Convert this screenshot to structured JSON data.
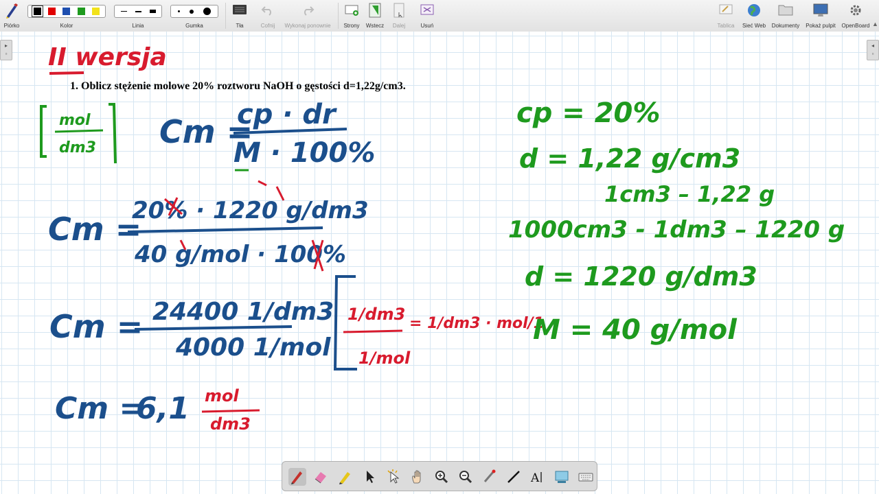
{
  "toolbar": {
    "pen_label": "Piórko",
    "color_label": "Kolor",
    "line_label": "Linia",
    "eraser_label": "Gumka",
    "background_label": "Tła",
    "undo_label": "Cofnij",
    "redo_label": "Wykonaj ponownie",
    "pages_label": "Strony",
    "back_label": "Wstecz",
    "next_label": "Dalej",
    "delete_label": "Usuń",
    "board_label": "Tablica",
    "web_label": "Sieć Web",
    "documents_label": "Dokumenty",
    "desktop_label": "Pokaż pulpit",
    "openboard_label": "OpenBoard",
    "colors": [
      "#000000",
      "#e00000",
      "#1e4fb0",
      "#1e9a1e",
      "#f2e21a"
    ]
  },
  "board": {
    "problem_text": "1. Oblicz stężenie molowe 20% roztworu NaOH o gęstości d=1,22g/cm3.",
    "ink_colors": {
      "red": "#d81b2e",
      "blue": "#1b4f8c",
      "green": "#1e9a1e"
    },
    "handwriting": {
      "title": "II wersja",
      "unit_box_num": "mol",
      "unit_box_den": "dm3",
      "formula_lhs": "Cm =",
      "formula_num": "cp · dr",
      "formula_den": "M · 100%",
      "step1_lhs": "Cm =",
      "step1_num": "20% · 1220 g/dm3",
      "step1_den": "40 g/mol · 100%",
      "step2_lhs": "Cm =",
      "step2_num": "24400 1/dm3",
      "step2_den": "4000 1/mol",
      "unit_num": "1/dm3",
      "unit_den": "1/mol",
      "unit_eq": "= 1/dm3 · mol/1",
      "result_lhs": "Cm =",
      "result_value": "6,1",
      "result_num": "mol",
      "result_den": "dm3",
      "given_cp": "cp = 20%",
      "given_d": "d = 1,22 g/cm3",
      "given_conv1": "1cm3 – 1,22 g",
      "given_conv2": "1000cm3 - 1dm3 – 1220 g",
      "given_d2": "d = 1220 g/dm3",
      "given_M": "M = 40 g/mol"
    }
  },
  "bottom_tools": [
    "pen-tool",
    "eraser-tool",
    "marker-tool",
    "selector-tool",
    "interactor-tool",
    "hand-tool",
    "zoom-in-tool",
    "zoom-out-tool",
    "laser-pointer-tool",
    "line-tool",
    "text-tool",
    "capture-tool",
    "virtual-keyboard-tool"
  ]
}
